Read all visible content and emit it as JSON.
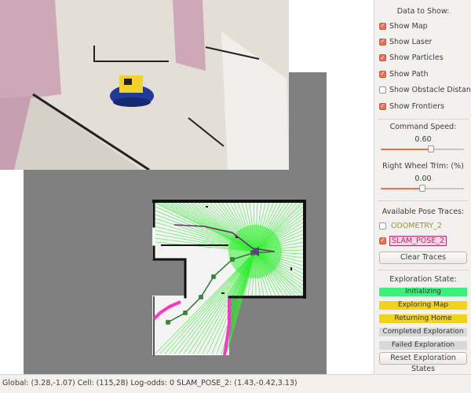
{
  "data_to_show": {
    "title": "Data to Show:",
    "options": [
      {
        "label": "Show Map",
        "checked": true
      },
      {
        "label": "Show Laser",
        "checked": true
      },
      {
        "label": "Show Particles",
        "checked": true
      },
      {
        "label": "Show Path",
        "checked": true
      },
      {
        "label": "Show Obstacle Distances",
        "checked": false
      },
      {
        "label": "Show Frontiers",
        "checked": true
      }
    ]
  },
  "command_speed": {
    "title": "Command Speed:",
    "value": "0.60",
    "fraction": 0.6
  },
  "right_wheel_trim": {
    "title": "Right Wheel Trim: (%)",
    "value": "0.00",
    "fraction": 0.5
  },
  "pose_traces": {
    "title": "Available Pose Traces:",
    "traces": [
      {
        "label": "ODOMETRY_2",
        "checked": false,
        "color": "#9a9a1a"
      },
      {
        "label": "SLAM_POSE_2",
        "checked": true,
        "color": "#b0306a"
      }
    ],
    "clear_label": "Clear Traces"
  },
  "exploration": {
    "title": "Exploration State:",
    "states": [
      {
        "label": "Initializing",
        "color": "#3cf07a"
      },
      {
        "label": "Exploring Map",
        "color": "#f2d21a"
      },
      {
        "label": "Returning Home",
        "color": "#f2d21a"
      },
      {
        "label": "Completed Exploration",
        "color": "#d9d9d9"
      },
      {
        "label": "Failed Exploration",
        "color": "#d9d9d9"
      }
    ],
    "reset_label": "Reset Exploration States"
  },
  "status_bar": {
    "text": "Global: (3.28,-1.07) Cell: (115,28) Log-odds: 0   SLAM_POSE_2: (1.43,-0.42,3.13)"
  },
  "colors": {
    "laser": "#33ee33",
    "frontier": "#ff33cc",
    "unknown": "#808080",
    "free": "#ffffff",
    "wall": "#111111",
    "slam_path": "#2a9a2a",
    "odometry_path": "#6a2a6a"
  }
}
